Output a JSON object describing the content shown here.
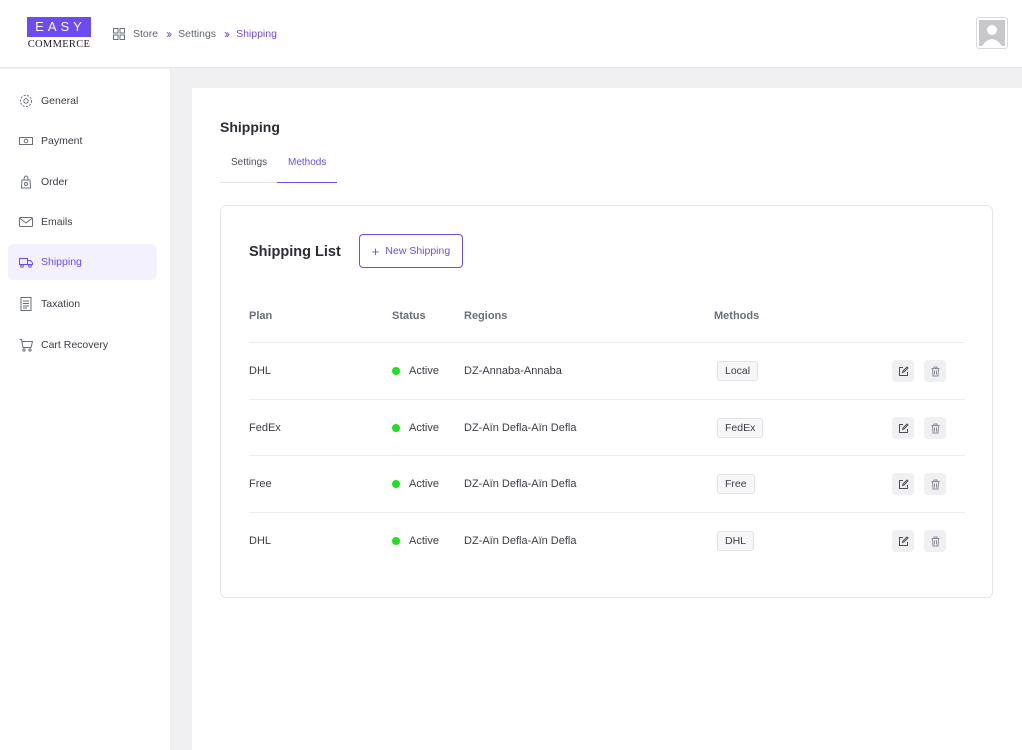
{
  "header": {
    "logo_top": "EASY",
    "logo_bottom": "COMMERCE",
    "breadcrumb": [
      "Store",
      "Settings",
      "Shipping"
    ]
  },
  "sidebar": {
    "items": [
      {
        "label": "General",
        "icon": "gear-icon"
      },
      {
        "label": "Payment",
        "icon": "money-icon"
      },
      {
        "label": "Order",
        "icon": "bag-icon"
      },
      {
        "label": "Emails",
        "icon": "mail-icon"
      },
      {
        "label": "Shipping",
        "icon": "truck-icon",
        "active": true
      },
      {
        "label": "Taxation",
        "icon": "receipt-icon"
      },
      {
        "label": "Cart Recovery",
        "icon": "cart-icon"
      }
    ]
  },
  "main": {
    "title": "Shipping",
    "tabs": [
      {
        "label": "Settings"
      },
      {
        "label": "Methods",
        "active": true
      }
    ],
    "card": {
      "title": "Shipping List",
      "new_button": "New Shipping",
      "columns": [
        "Plan",
        "Status",
        "Regions",
        "Methods"
      ],
      "rows": [
        {
          "plan": "DHL",
          "status": "Active",
          "region": "DZ-Annaba-Annaba",
          "method": "Local"
        },
        {
          "plan": "FedEx",
          "status": "Active",
          "region": "DZ-Aïn Defla-Aïn Defla",
          "method": "FedEx"
        },
        {
          "plan": "Free",
          "status": "Active",
          "region": "DZ-Aïn Defla-Aïn Defla",
          "method": "Free"
        },
        {
          "plan": "DHL",
          "status": "Active",
          "region": "DZ-Aïn Defla-Aïn Defla",
          "method": "DHL"
        }
      ]
    }
  },
  "colors": {
    "accent": "#6c4bf2",
    "active_dot": "#1ee01e",
    "page_bg": "#f0f0f2"
  }
}
